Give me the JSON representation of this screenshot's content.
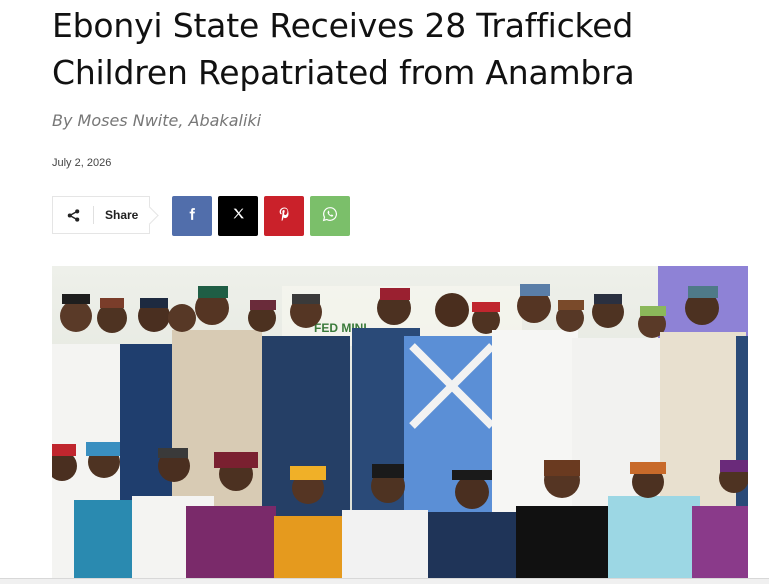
{
  "article": {
    "title_line1": "Ebonyi State Receives 28 Trafficked",
    "title_line2": "Children Repatriated from Anambra",
    "byline": "By Moses Nwite, Abakaliki",
    "date": "July 2, 2026"
  },
  "share": {
    "label": "Share",
    "icon": "share-icon",
    "buttons": [
      {
        "network": "facebook",
        "icon": "facebook-icon",
        "color": "#516eab"
      },
      {
        "network": "x",
        "icon": "x-icon",
        "color": "#000000"
      },
      {
        "network": "pinterest",
        "icon": "pinterest-icon",
        "color": "#ca212a"
      },
      {
        "network": "whatsapp",
        "icon": "whatsapp-icon",
        "color": "#7bbf6a"
      }
    ]
  },
  "photo": {
    "subject": "group-photo"
  }
}
